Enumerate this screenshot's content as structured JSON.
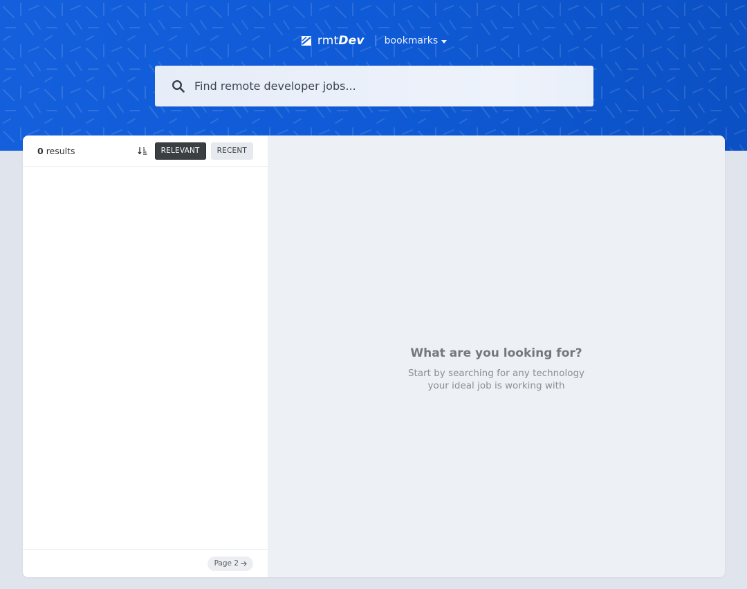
{
  "header": {
    "logo_text_light": "rmt",
    "logo_text_bold": "Dev",
    "bookmarks_label": "bookmarks",
    "background_color": "#1460dc"
  },
  "search": {
    "placeholder": "Find remote developer jobs...",
    "value": ""
  },
  "sidebar": {
    "results_count": "0",
    "results_label": "results",
    "sort_buttons": {
      "relevant": "RELEVANT",
      "recent": "RECENT",
      "active": "relevant"
    },
    "pagination": {
      "next_label": "Page 2"
    }
  },
  "detail": {
    "empty_title": "What are you looking for?",
    "empty_line1": "Start by searching for any technology",
    "empty_line2": "your ideal job is working with"
  },
  "icons": {
    "logo": "rmtdev-logo-icon",
    "search": "search-icon",
    "sort": "sort-descending-icon",
    "caret": "caret-down-icon",
    "arrow": "arrow-right-icon"
  }
}
